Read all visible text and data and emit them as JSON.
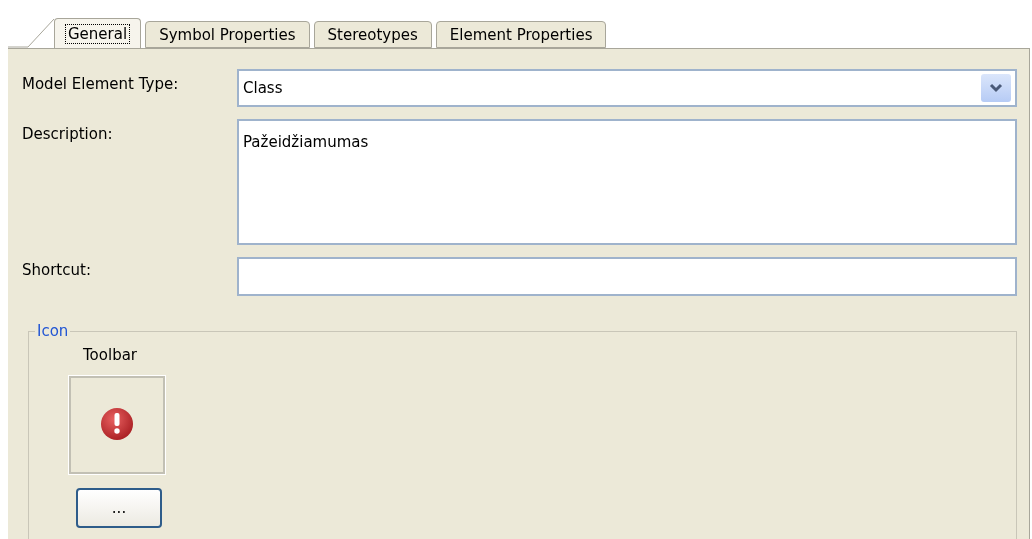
{
  "tabs": [
    {
      "label": "General",
      "selected": true
    },
    {
      "label": "Symbol Properties",
      "selected": false
    },
    {
      "label": "Stereotypes",
      "selected": false
    },
    {
      "label": "Element Properties",
      "selected": false
    }
  ],
  "model_element_type": {
    "label": "Model Element Type:",
    "value": "Class"
  },
  "description": {
    "label": "Description:",
    "value": "Pažeidžiamumas"
  },
  "shortcut": {
    "label": "Shortcut:"
  },
  "icon_group": {
    "title": "Icon",
    "toolbar_label": "Toolbar",
    "browse_button": "..."
  }
}
